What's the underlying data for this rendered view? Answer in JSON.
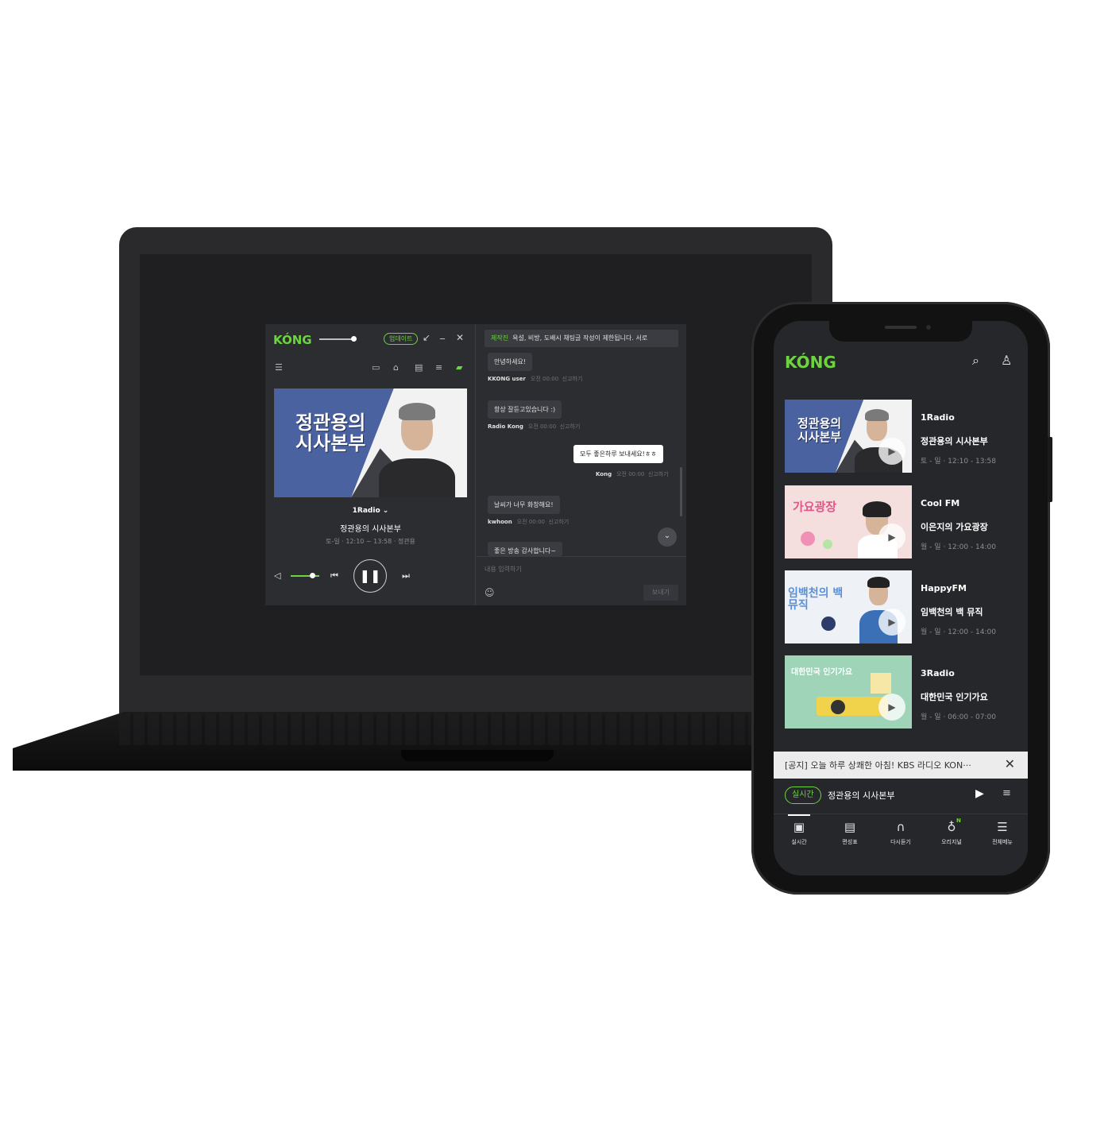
{
  "desktop": {
    "logo": "KÓNG",
    "update_label": "업데이트",
    "window_controls": {
      "shrink": "↙",
      "minimize": "_",
      "close": "✕"
    },
    "cover_title_line1": "정관용의",
    "cover_title_line2": "시사본부",
    "station": "1Radio",
    "program": "정관용의 시사본부",
    "schedule": "토-일 · 12:10 ~ 13:58 · 정관용",
    "chat": {
      "notice_tag": "제작진",
      "notice_text": "욕설, 비방, 도배시 채팅글 작성이 제한됩니다. 서로",
      "messages": [
        {
          "text": "안녕하세요!",
          "user": "KKONG user",
          "time": "오전 00:00",
          "report": "신고하기"
        },
        {
          "text": "항상 잘듣고있습니다 :)",
          "user": "Radio Kong",
          "time": "오전 00:00",
          "report": "신고하기"
        },
        {
          "text": "모두 좋은하루 보내세요!ㅎㅎ",
          "user": "Kong",
          "time": "오전 00:00",
          "report": "신고하기"
        },
        {
          "text": "날씨가 너무 화창해요!",
          "user": "kwhoon",
          "time": "오전 00:00",
          "report": "신고하기"
        },
        {
          "text": "좋은 방송 감사합니다~"
        }
      ],
      "input_placeholder": "내용 입력하기",
      "send_label": "보내기"
    }
  },
  "mobile": {
    "logo": "KÓNG",
    "cards": [
      {
        "channel": "1Radio",
        "title": "정관용의 시사본부",
        "time": "토 - 일 · 12:10 - 13:58",
        "thumb_text": "정관용의 시사본부"
      },
      {
        "channel": "Cool FM",
        "title": "이은지의 가요광장",
        "time": "월 - 일 · 12:00 - 14:00",
        "thumb_text": "가요광장"
      },
      {
        "channel": "HappyFM",
        "title": "임백천의 백 뮤직",
        "time": "월 - 일 · 12:00 - 14:00",
        "thumb_text": "임백천의 백 뮤직"
      },
      {
        "channel": "3Radio",
        "title": "대한민국 인기가요",
        "time": "월 - 일 · 06:00 - 07:00",
        "thumb_text": "대한민국 인기가요"
      }
    ],
    "notice": "[공지] 오늘 하루 상쾌한 아침! KBS 라디오 KON···",
    "now_playing": {
      "badge": "실시간",
      "title": "정관용의 시사본부"
    },
    "tabs": [
      {
        "label": "실시간"
      },
      {
        "label": "편성표"
      },
      {
        "label": "다시듣기"
      },
      {
        "label": "오리지널"
      },
      {
        "label": "전체메뉴"
      }
    ]
  },
  "colors": {
    "accent": "#6dd43f",
    "background": "#26272b",
    "cover_blue": "#4a63a0"
  }
}
